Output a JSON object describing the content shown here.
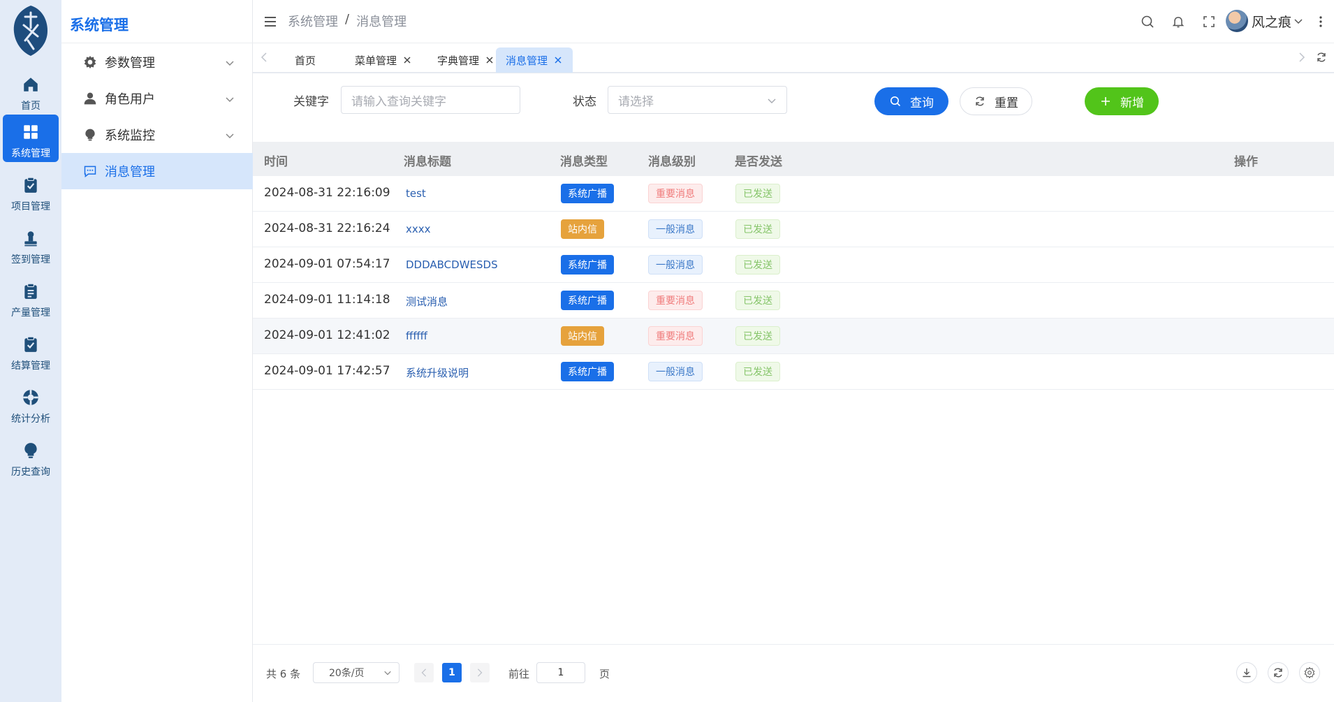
{
  "rail": {
    "items": [
      {
        "label": "首页",
        "icon": "home-icon"
      },
      {
        "label": "系统管理",
        "icon": "grid-icon"
      },
      {
        "label": "项目管理",
        "icon": "clipboard-check-icon"
      },
      {
        "label": "签到管理",
        "icon": "stamp-icon"
      },
      {
        "label": "产量管理",
        "icon": "clipboard-list-icon"
      },
      {
        "label": "结算管理",
        "icon": "clipboard-check-icon"
      },
      {
        "label": "统计分析",
        "icon": "lifebuoy-icon"
      },
      {
        "label": "历史查询",
        "icon": "bulb-icon"
      }
    ]
  },
  "menu": {
    "title": "系统管理",
    "items": [
      {
        "label": "参数管理",
        "icon": "gear-icon"
      },
      {
        "label": "角色用户",
        "icon": "user-icon"
      },
      {
        "label": "系统监控",
        "icon": "bulb-icon"
      },
      {
        "label": "消息管理",
        "icon": "message-icon"
      }
    ]
  },
  "header": {
    "breadcrumb": [
      "系统管理",
      "消息管理"
    ],
    "separator": "/",
    "username": "风之痕"
  },
  "tabs": [
    {
      "label": "首页"
    },
    {
      "label": "菜单管理"
    },
    {
      "label": "字典管理"
    },
    {
      "label": "消息管理"
    }
  ],
  "form": {
    "keyword_label": "关键字",
    "keyword_placeholder": "请输入查询关键字",
    "status_label": "状态",
    "status_placeholder": "请选择",
    "query_label": "查询",
    "reset_label": "重置",
    "add_label": "新增"
  },
  "table": {
    "columns": [
      "时间",
      "消息标题",
      "消息类型",
      "消息级别",
      "是否发送",
      "操作"
    ],
    "rows": [
      {
        "time": "2024-08-31 22:16:09",
        "title": "test",
        "type": "系统广播",
        "level": "重要消息",
        "sent": "已发送"
      },
      {
        "time": "2024-08-31 22:16:24",
        "title": "xxxx",
        "type": "站内信",
        "level": "一般消息",
        "sent": "已发送"
      },
      {
        "time": "2024-09-01 07:54:17",
        "title": "DDDABCDWESDS",
        "type": "系统广播",
        "level": "一般消息",
        "sent": "已发送"
      },
      {
        "time": "2024-09-01 11:14:18",
        "title": "测试消息",
        "type": "系统广播",
        "level": "重要消息",
        "sent": "已发送"
      },
      {
        "time": "2024-09-01 12:41:02",
        "title": "ffffff",
        "type": "站内信",
        "level": "重要消息",
        "sent": "已发送"
      },
      {
        "time": "2024-09-01 17:42:57",
        "title": "系统升级说明",
        "type": "系统广播",
        "level": "一般消息",
        "sent": "已发送"
      }
    ]
  },
  "pagination": {
    "total": "共 6 条",
    "page_size": "20条/页",
    "current_page": "1",
    "goto_label": "前往",
    "goto_value": "1",
    "page_suffix": "页"
  },
  "colors": {
    "primary": "#1a6fe8",
    "success": "#52c41a",
    "warning": "#e6a23c",
    "rail_bg": "#e3ebf7",
    "active_menu_bg": "#d6e6fb"
  }
}
